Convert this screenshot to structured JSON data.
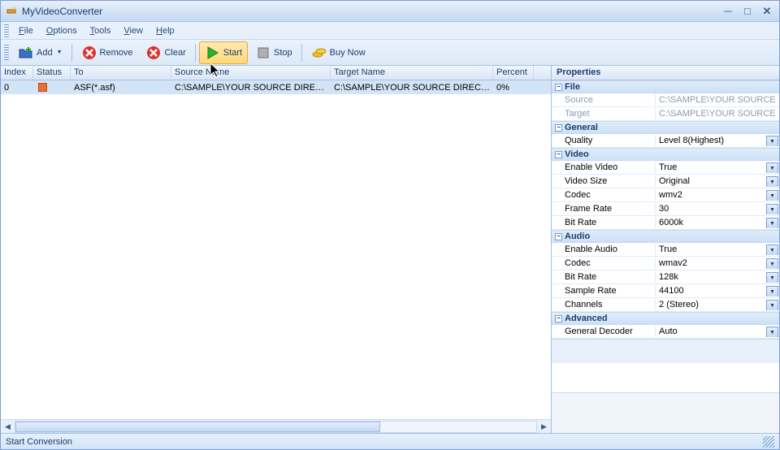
{
  "title": "MyVideoConverter",
  "menu": {
    "file": "File",
    "options": "Options",
    "tools": "Tools",
    "view": "View",
    "help": "Help"
  },
  "toolbar": {
    "add": "Add",
    "remove": "Remove",
    "clear": "Clear",
    "start": "Start",
    "stop": "Stop",
    "buy": "Buy Now"
  },
  "columns": {
    "index": "Index",
    "status": "Status",
    "to": "To",
    "source": "Source Name",
    "target": "Target Name",
    "percent": "Percent"
  },
  "rows": [
    {
      "index": "0",
      "to": "ASF(*.asf)",
      "source": "C:\\SAMPLE\\YOUR SOURCE DIRECTOR...",
      "target": "C:\\SAMPLE\\YOUR SOURCE DIRECTOR...",
      "percent": "0%"
    }
  ],
  "properties": {
    "header": "Properties",
    "sections": {
      "file": "File",
      "general": "General",
      "video": "Video",
      "audio": "Audio",
      "advanced": "Advanced"
    },
    "file": {
      "source_label": "Source",
      "source_value": "C:\\SAMPLE\\YOUR SOURCE",
      "target_label": "Target",
      "target_value": "C:\\SAMPLE\\YOUR SOURCE"
    },
    "general": {
      "quality_label": "Quality",
      "quality_value": "Level 8(Highest)"
    },
    "video": {
      "enable_label": "Enable Video",
      "enable_value": "True",
      "size_label": "Video Size",
      "size_value": "Original",
      "codec_label": "Codec",
      "codec_value": "wmv2",
      "fps_label": "Frame Rate",
      "fps_value": "30",
      "bitrate_label": "Bit Rate",
      "bitrate_value": "6000k"
    },
    "audio": {
      "enable_label": "Enable Audio",
      "enable_value": "True",
      "codec_label": "Codec",
      "codec_value": "wmav2",
      "bitrate_label": "Bit Rate",
      "bitrate_value": "128k",
      "sample_label": "Sample Rate",
      "sample_value": "44100",
      "channels_label": "Channels",
      "channels_value": "2 (Stereo)"
    },
    "advanced": {
      "decoder_label": "General Decoder",
      "decoder_value": "Auto"
    }
  },
  "status": "Start Conversion"
}
